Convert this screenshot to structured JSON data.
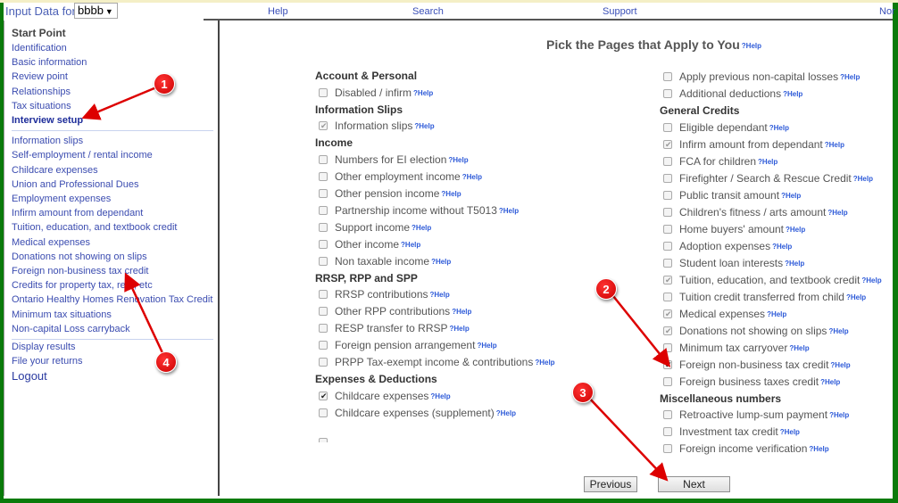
{
  "topbar": {
    "input_data_for_label": "Input Data for:",
    "client_selected": "bbbb",
    "links": [
      "Help",
      "Search",
      "Support",
      "Nor"
    ]
  },
  "sidebar": {
    "title": "Start Point",
    "group1": [
      "Identification",
      "Basic information",
      "Review point",
      "Relationships",
      "Tax situations",
      "Interview setup"
    ],
    "group2": [
      "Information slips",
      "Self-employment / rental income",
      "Childcare expenses",
      "Union and Professional Dues",
      "Employment expenses",
      "Infirm amount from dependant",
      "Tuition, education, and textbook credit",
      "Medical expenses",
      "Donations not showing on slips",
      "Foreign non-business tax credit",
      "Credits for property tax, rent, etc",
      "Ontario Healthy Homes Renovation Tax Credit",
      "Minimum tax situations",
      "Non-capital Loss carryback"
    ],
    "group3": [
      "Display results",
      "File your returns"
    ],
    "logout": "Logout",
    "active_item": "Interview setup"
  },
  "main": {
    "title": "Pick the Pages that Apply to You",
    "help_label": "?Help",
    "left_column": [
      {
        "type": "section",
        "label": "Account & Personal"
      },
      {
        "type": "option",
        "label": "Disabled / infirm",
        "checked": false,
        "disabled": false
      },
      {
        "type": "section",
        "label": "Information Slips"
      },
      {
        "type": "option",
        "label": "Information slips",
        "checked": true,
        "disabled": true
      },
      {
        "type": "section",
        "label": "Income"
      },
      {
        "type": "option",
        "label": "Numbers for EI election",
        "checked": false,
        "disabled": false
      },
      {
        "type": "option",
        "label": "Other employment income",
        "checked": false,
        "disabled": false
      },
      {
        "type": "option",
        "label": "Other pension income",
        "checked": false,
        "disabled": false
      },
      {
        "type": "option",
        "label": "Partnership income without T5013",
        "checked": false,
        "disabled": false
      },
      {
        "type": "option",
        "label": "Support income",
        "checked": false,
        "disabled": false
      },
      {
        "type": "option",
        "label": "Other income",
        "checked": false,
        "disabled": false
      },
      {
        "type": "option",
        "label": "Non taxable income",
        "checked": false,
        "disabled": false
      },
      {
        "type": "section",
        "label": "RRSP, RPP and SPP"
      },
      {
        "type": "option",
        "label": "RRSP contributions",
        "checked": false,
        "disabled": false
      },
      {
        "type": "option",
        "label": "Other RPP contributions",
        "checked": false,
        "disabled": false
      },
      {
        "type": "option",
        "label": "RESP transfer to RRSP",
        "checked": false,
        "disabled": false
      },
      {
        "type": "option",
        "label": "Foreign pension arrangement",
        "checked": false,
        "disabled": false
      },
      {
        "type": "option",
        "label": "PRPP Tax-exempt income & contributions",
        "checked": false,
        "disabled": false
      },
      {
        "type": "section",
        "label": "Expenses & Deductions"
      },
      {
        "type": "option",
        "label": "Childcare expenses",
        "checked": true,
        "disabled": false
      },
      {
        "type": "option",
        "label": "Childcare expenses (supplement)",
        "checked": false,
        "disabled": false
      }
    ],
    "right_column": [
      {
        "type": "option",
        "label": "Apply previous non-capital losses",
        "checked": false,
        "disabled": false
      },
      {
        "type": "option",
        "label": "Additional deductions",
        "checked": false,
        "disabled": false
      },
      {
        "type": "section",
        "label": "General Credits"
      },
      {
        "type": "option",
        "label": "Eligible dependant",
        "checked": false,
        "disabled": false
      },
      {
        "type": "option",
        "label": "Infirm amount from dependant",
        "checked": true,
        "disabled": true
      },
      {
        "type": "option",
        "label": "FCA for children",
        "checked": false,
        "disabled": false
      },
      {
        "type": "option",
        "label": "Firefighter / Search & Rescue Credit",
        "checked": false,
        "disabled": false
      },
      {
        "type": "option",
        "label": "Public transit amount",
        "checked": false,
        "disabled": false
      },
      {
        "type": "option",
        "label": "Children's fitness / arts amount",
        "checked": false,
        "disabled": false
      },
      {
        "type": "option",
        "label": "Home buyers' amount",
        "checked": false,
        "disabled": false
      },
      {
        "type": "option",
        "label": "Adoption expenses",
        "checked": false,
        "disabled": false
      },
      {
        "type": "option",
        "label": "Student loan interests",
        "checked": false,
        "disabled": false
      },
      {
        "type": "option",
        "label": "Tuition, education, and textbook credit",
        "checked": true,
        "disabled": true
      },
      {
        "type": "option",
        "label": "Tuition credit transferred from child",
        "checked": false,
        "disabled": false
      },
      {
        "type": "option",
        "label": "Medical expenses",
        "checked": true,
        "disabled": true
      },
      {
        "type": "option",
        "label": "Donations not showing on slips",
        "checked": true,
        "disabled": true
      },
      {
        "type": "option",
        "label": "Minimum tax carryover",
        "checked": false,
        "disabled": false
      },
      {
        "type": "option",
        "label": "Foreign non-business tax credit",
        "checked": true,
        "disabled": false
      },
      {
        "type": "option",
        "label": "Foreign business taxes credit",
        "checked": false,
        "disabled": false
      },
      {
        "type": "section",
        "label": "Miscellaneous numbers"
      },
      {
        "type": "option",
        "label": "Retroactive lump-sum payment",
        "checked": false,
        "disabled": false
      },
      {
        "type": "option",
        "label": "Investment tax credit",
        "checked": false,
        "disabled": false
      },
      {
        "type": "option",
        "label": "Foreign income verification",
        "checked": false,
        "disabled": false
      }
    ],
    "buttons": {
      "previous": "Previous",
      "next": "Next"
    }
  },
  "annotations": [
    "1",
    "2",
    "3",
    "4"
  ],
  "colors": {
    "frame": "#0a7a0a",
    "link": "#3b4cb0",
    "help": "#2d5ad8",
    "annotation": "#dd0000"
  }
}
